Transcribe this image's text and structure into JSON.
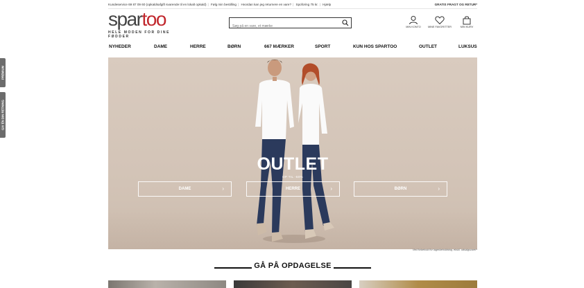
{
  "topbar": {
    "customer_service": "Kundeservice 69 87 09 60 (opkaldsafgift svarende til en lokalt opkald)",
    "track_order": "Følg min bestilling",
    "returns": "Hvordan kan jeg returnere en vare?",
    "shipping": "Spoforing 75 kr.",
    "help": "Hjælp",
    "free_shipping": "GRATIS FRAGT OG RETUR*"
  },
  "logo": {
    "part1": "spar",
    "part2": "too",
    "tagline": "HELE MODEN FOR DINE FØDDER"
  },
  "search": {
    "placeholder": "Søg på en vare, et mærke"
  },
  "header_icons": {
    "account": "MIN KONTO",
    "favorites": "MINE FAVORITTER",
    "cart": "MIN KURV"
  },
  "nav": [
    "NYHEDER",
    "DAME",
    "HERRE",
    "BØRN",
    "667 MÆRKER",
    "SPORT",
    "KUN HOS SPARTOO",
    "OUTLET",
    "LUKSUS"
  ],
  "side_tabs": {
    "premium": "PREMIUM",
    "gift": "GIV ÉN DIN RETNING"
  },
  "hero": {
    "title": "OUTLET",
    "subtitle": "OP TIL -60%",
    "buttons": [
      "DAME",
      "HERRE",
      "BØRN"
    ],
    "disclaimer": "Ved forbehold for lagerbeholdning, ekskl. udsalgsvarer*"
  },
  "discover": {
    "title": "GÅ PÅ OPDAGELSE"
  },
  "colors": {
    "brand_red": "#c1272d",
    "hero_bg": "#d5c6b9",
    "side_tab": "#6c6c6c"
  }
}
